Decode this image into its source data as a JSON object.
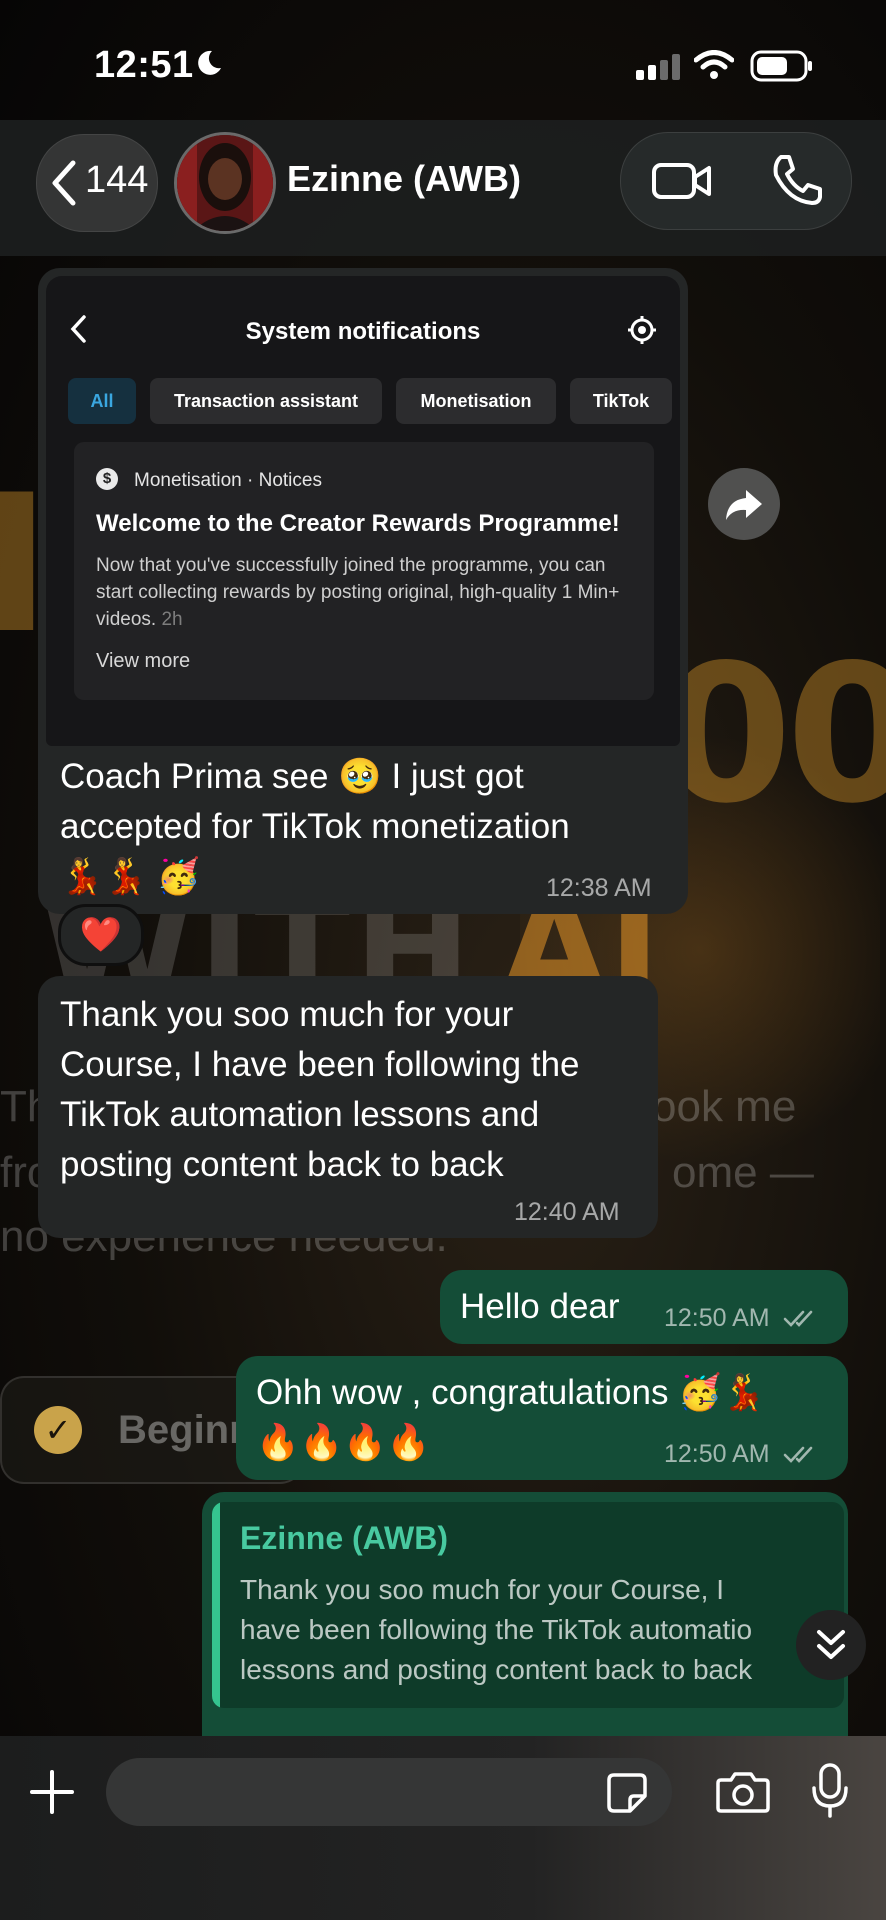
{
  "status_bar": {
    "time": "12:51"
  },
  "header": {
    "back_count": "144",
    "contact_name": "Ezinne (AWB)"
  },
  "messages": {
    "m1": {
      "image": {
        "title": "System notifications",
        "chips": [
          "All",
          "Transaction assistant",
          "Monetisation",
          "TikTok"
        ],
        "card_source": "Monetisation · Notices",
        "card_title": "Welcome to the Creator Rewards Programme!",
        "card_body": "Now that you've successfully joined the programme, you can start collecting rewards by posting original, high-quality 1 Min+ videos.",
        "card_age": "2h",
        "card_more": "View more"
      },
      "text_line1": "Coach Prima see 🥹 I just got",
      "text_line2": "accepted for TikTok monetization",
      "text_line3": "💃💃 🥳",
      "time": "12:38 AM",
      "reaction": "❤️"
    },
    "m2": {
      "lines": [
        "Thank you soo much for your",
        "Course, I have been following the",
        "TikTok automation lessons and",
        "posting content back to back"
      ],
      "time": "12:40 AM"
    },
    "m3": {
      "text": "Hello dear",
      "time": "12:50 AM"
    },
    "m4": {
      "line1": "Ohh wow , congratulations 🥳💃",
      "line2": "🔥🔥🔥🔥",
      "time": "12:50 AM"
    },
    "m5": {
      "quote_name": "Ezinne (AWB)",
      "quote_lines": [
        "Thank you soo much for your Course, I",
        "have been following the TikTok automatio",
        "lessons and posting content back to back"
      ]
    }
  },
  "background": {
    "big1": "I",
    "big2": "00",
    "big3": "WITH",
    "big4": "AI",
    "line_a": "Th",
    "line_b": "ook me",
    "line_c": "fro",
    "line_d": "ome —",
    "line_e": "no experience needed.",
    "pill_label": "Beginn"
  },
  "composer": {
    "placeholder": ""
  },
  "colors": {
    "incoming": "#242626",
    "outgoing": "#144d37",
    "accent": "#48c9a0"
  }
}
